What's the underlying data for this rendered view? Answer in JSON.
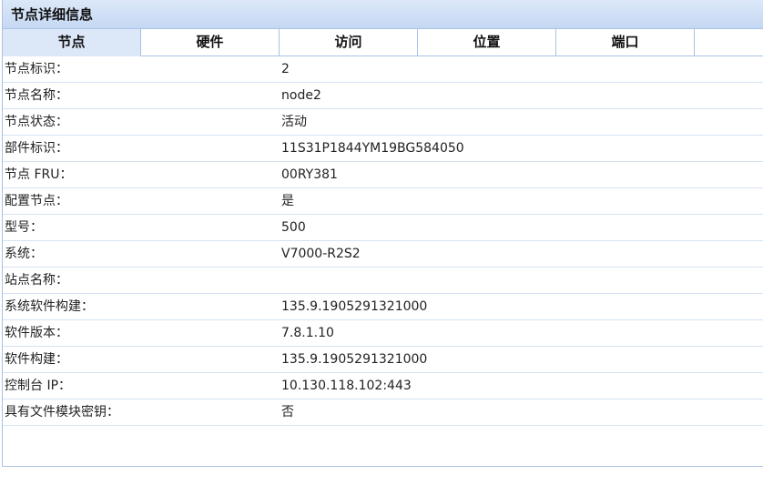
{
  "panel": {
    "title": "节点详细信息"
  },
  "tabs": [
    {
      "label": "节点",
      "active": true
    },
    {
      "label": "硬件",
      "active": false
    },
    {
      "label": "访问",
      "active": false
    },
    {
      "label": "位置",
      "active": false
    },
    {
      "label": "端口",
      "active": false
    }
  ],
  "rows": [
    {
      "label": "节点标识：",
      "value": "2"
    },
    {
      "label": "节点名称：",
      "value": "node2"
    },
    {
      "label": "节点状态：",
      "value": "活动"
    },
    {
      "label": "部件标识：",
      "value": "11S31P1844YM19BG584050"
    },
    {
      "label": "节点 FRU：",
      "value": "00RY381"
    },
    {
      "label": "配置节点：",
      "value": "是"
    },
    {
      "label": "型号：",
      "value": "500"
    },
    {
      "label": "系统：",
      "value": "V7000-R2S2"
    },
    {
      "label": "站点名称：",
      "value": ""
    },
    {
      "label": "系统软件构建：",
      "value": "135.9.1905291321000"
    },
    {
      "label": "软件版本：",
      "value": "7.8.1.10"
    },
    {
      "label": "软件构建：",
      "value": "135.9.1905291321000"
    },
    {
      "label": "控制台 IP：",
      "value": "10.130.118.102:443"
    },
    {
      "label": "具有文件模块密钥：",
      "value": "否"
    }
  ]
}
